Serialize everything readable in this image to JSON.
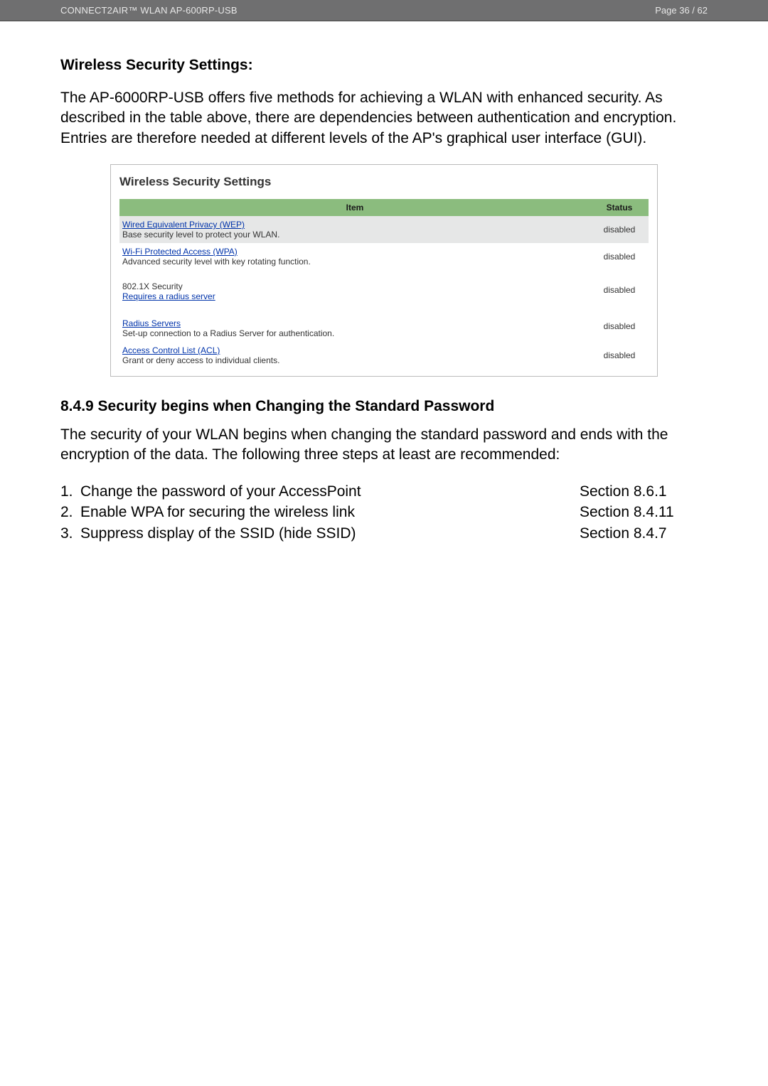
{
  "header": {
    "left": "CONNECT2AIR™ WLAN AP-600RP-USB",
    "right": "Page 36 / 62"
  },
  "section1": {
    "heading": "Wireless Security Settings:",
    "paragraph": "The AP-6000RP-USB offers five methods for achieving a WLAN with enhanced security. As described in the table above, there are dependencies between authentication and encryption. Entries are therefore needed at different levels of the AP's graphical user interface (GUI)."
  },
  "panel": {
    "title": "Wireless Security Settings",
    "columns": {
      "item": "Item",
      "status": "Status"
    },
    "rows": [
      {
        "link": "Wired Equivalent Privacy (WEP)",
        "desc": "Base security level to protect your WLAN.",
        "status": "disabled",
        "striped": true
      },
      {
        "link": "Wi-Fi Protected Access (WPA)",
        "desc": "Advanced security level with key rotating function.",
        "status": "disabled",
        "striped": false
      },
      {
        "pretext": "802.1X Security",
        "link": "Requires a radius server",
        "status": "disabled",
        "striped": false,
        "tall": true
      },
      {
        "link": "Radius Servers",
        "desc": "Set-up connection to a Radius Server for authentication.",
        "status": "disabled",
        "striped": false,
        "tall": true
      },
      {
        "link": "Access Control List (ACL)",
        "desc": "Grant or deny access to individual clients.",
        "status": "disabled",
        "striped": false
      }
    ]
  },
  "section2": {
    "heading": "8.4.9  Security begins when Changing the Standard Password",
    "paragraph": "The security of your WLAN begins when changing the standard password and ends with the encryption of the data. The following three steps at least are recommended:",
    "steps": [
      {
        "num": "1.",
        "text": "Change the password of your AccessPoint",
        "ref": "Section 8.6.1"
      },
      {
        "num": "2.",
        "text": "Enable WPA for securing the wireless link",
        "ref": "Section 8.4.11"
      },
      {
        "num": "3.",
        "text": "Suppress display of the SSID (hide SSID)",
        "ref": "Section 8.4.7"
      }
    ]
  }
}
